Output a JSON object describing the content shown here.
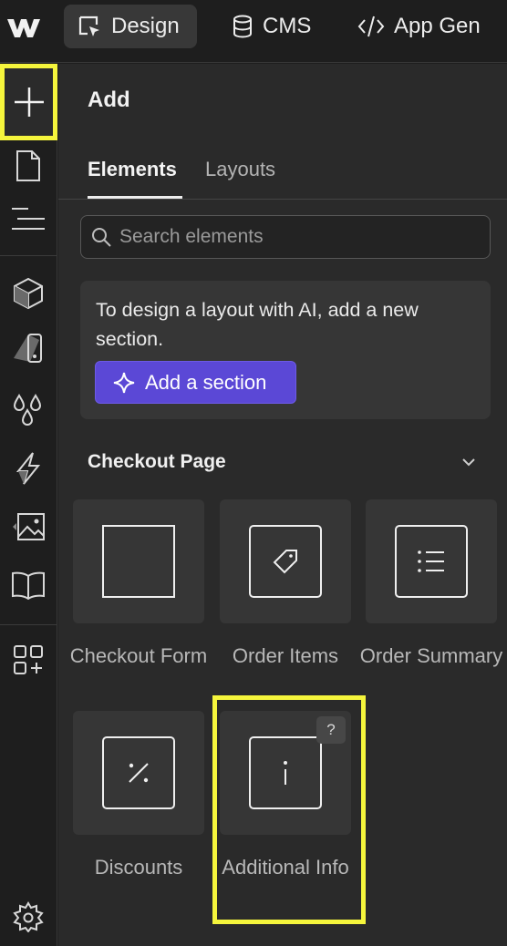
{
  "topbar": {
    "logo_icon": "webflow-logo-icon",
    "tabs": [
      {
        "label": "Design",
        "icon": "cursor-square-icon",
        "active": true
      },
      {
        "label": "CMS",
        "icon": "database-icon",
        "active": false
      },
      {
        "label": "App Gen",
        "icon": "code-icon",
        "active": false
      }
    ]
  },
  "rail": {
    "items": [
      {
        "icon": "plus-icon",
        "active": true
      },
      {
        "icon": "page-icon"
      },
      {
        "icon": "navigator-icon"
      },
      {
        "icon": "components-cube-icon"
      },
      {
        "icon": "styles-brush-icon"
      },
      {
        "icon": "variables-drops-icon"
      },
      {
        "icon": "interactions-bolt-icon"
      },
      {
        "icon": "assets-image-icon"
      },
      {
        "icon": "book-icon"
      },
      {
        "icon": "apps-icon"
      },
      {
        "icon": "settings-gear-icon"
      }
    ]
  },
  "panel": {
    "title": "Add",
    "tabs": [
      {
        "label": "Elements",
        "active": true
      },
      {
        "label": "Layouts",
        "active": false
      }
    ],
    "search": {
      "placeholder": "Search elements",
      "value": ""
    },
    "ai_card": {
      "text": "To design a layout with AI, add a new section.",
      "button_label": "Add a section"
    },
    "section": {
      "title": "Checkout Page",
      "expanded": true,
      "elements": [
        {
          "label": "Checkout Form",
          "icon": "square-icon"
        },
        {
          "label": "Order Items",
          "icon": "tag-icon"
        },
        {
          "label": "Order Summary",
          "icon": "list-icon"
        },
        {
          "label": "Discounts",
          "icon": "percent-icon"
        },
        {
          "label": "Additional Info",
          "icon": "info-icon",
          "help": "?"
        }
      ]
    }
  },
  "colors": {
    "highlight": "#f5f53c",
    "accent_button": "#5b48d6",
    "panel_bg": "#2a2a2a",
    "tile_bg": "#363636"
  }
}
